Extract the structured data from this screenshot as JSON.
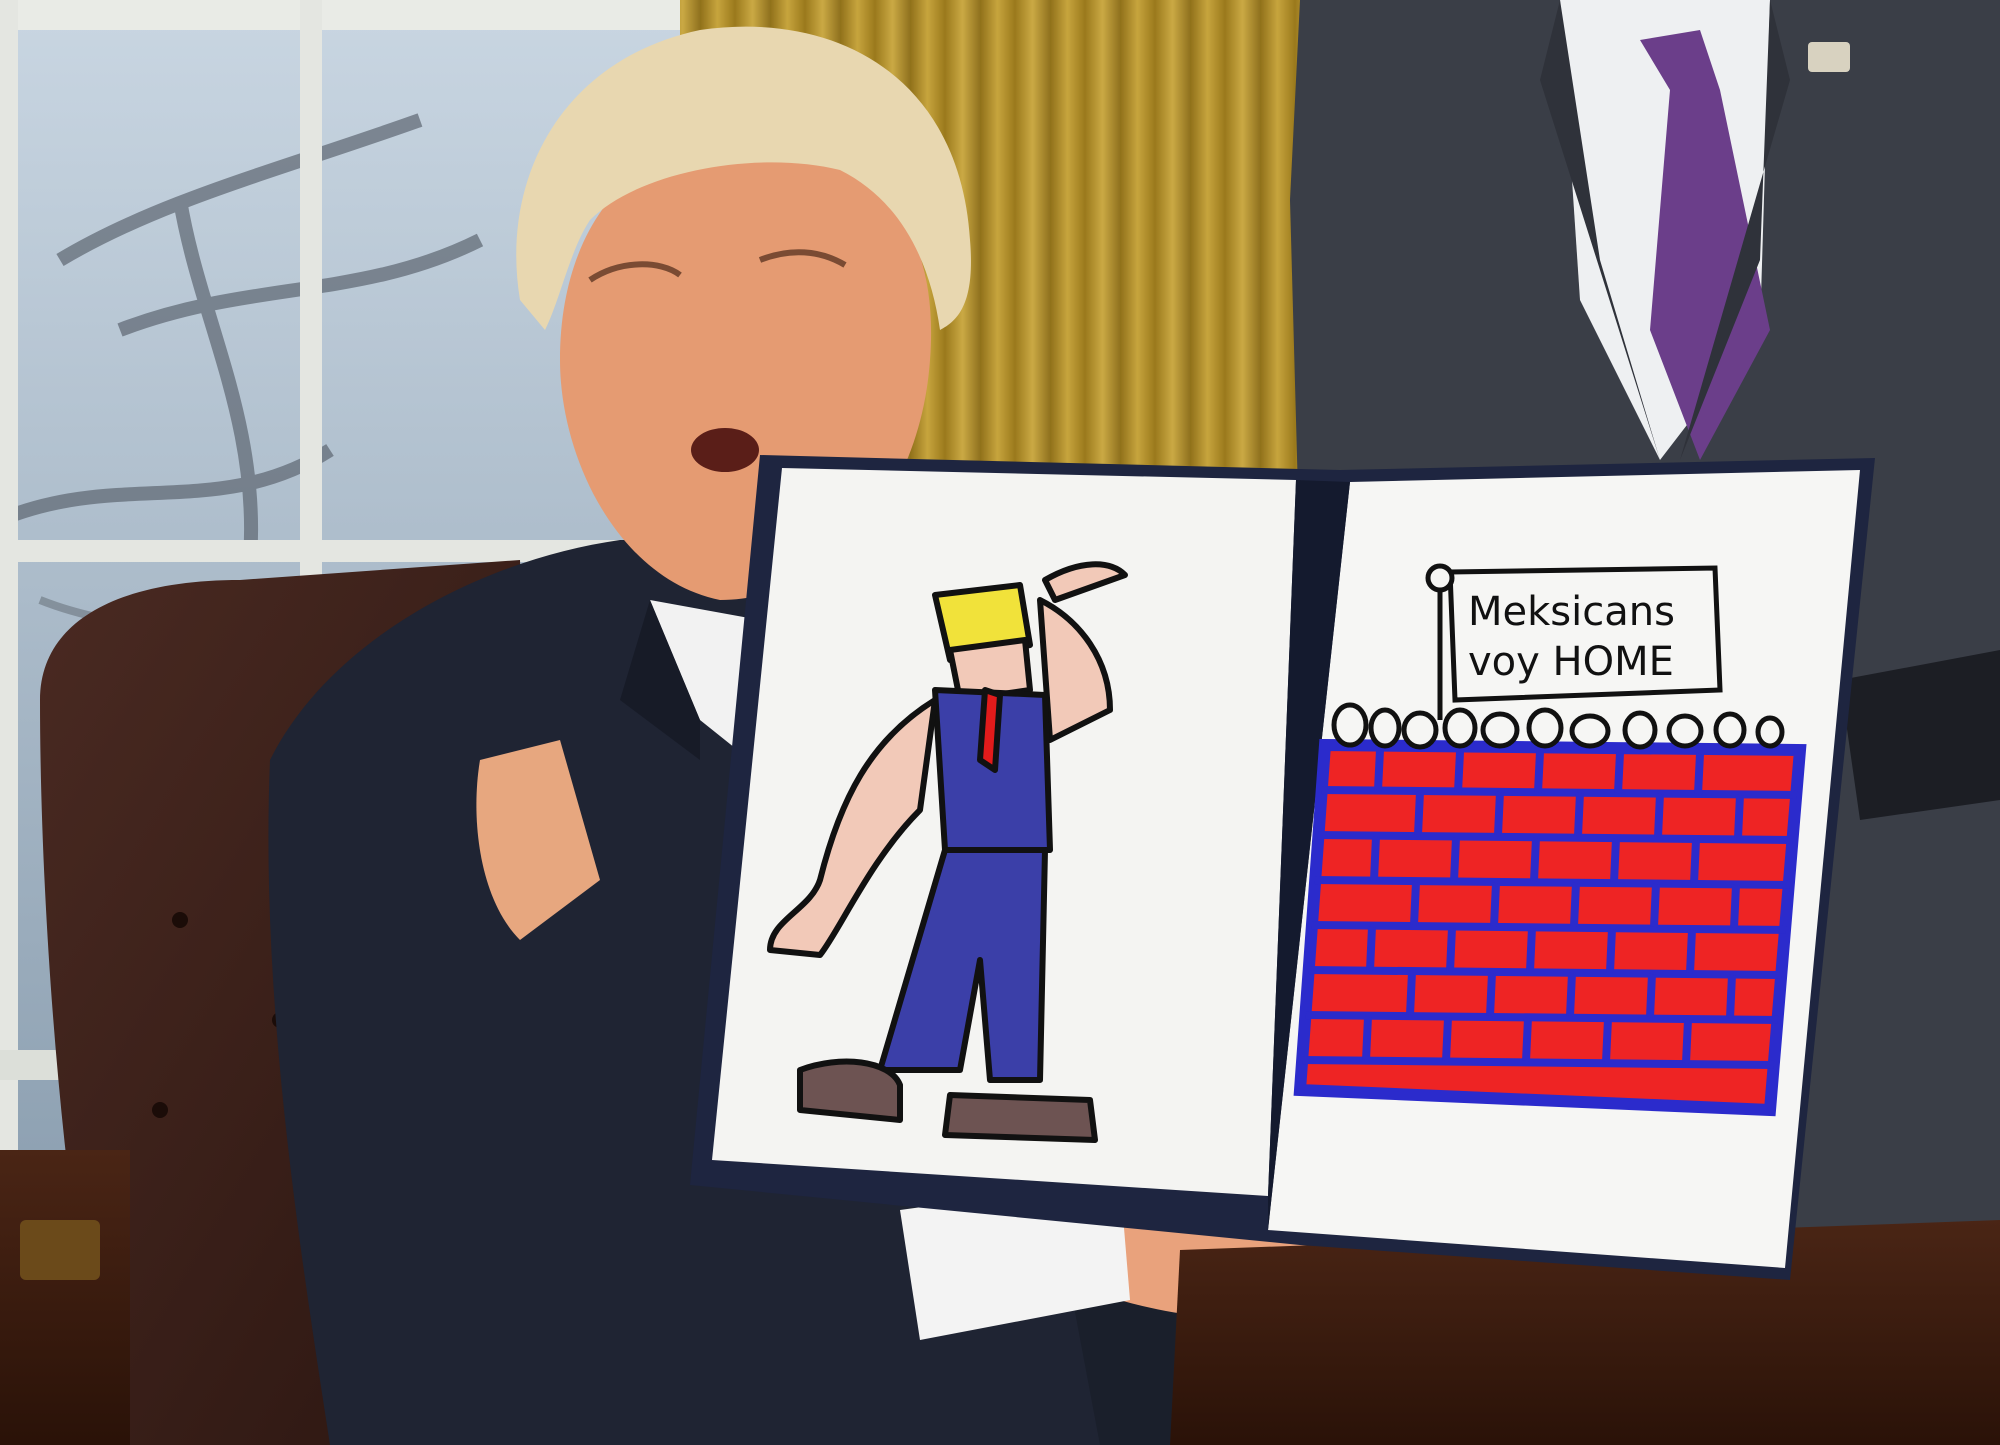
{
  "scene": {
    "type": "photo-meme",
    "colors": {
      "curtain": "#c9a133",
      "suit": "#1f2433",
      "folder": "#1e2540",
      "page": "#f4f4f2",
      "brick": "#ee2424",
      "mortar": "#2b2bcc",
      "figure_pants": "#3b3fa8",
      "figure_hair": "#f1e23a",
      "figure_tie": "#e21b1b",
      "skin_doodle": "#f2c9b8",
      "shoes": "#6d5352"
    }
  },
  "sign": {
    "line1": "Meksicans",
    "line2": "voy HOME"
  }
}
